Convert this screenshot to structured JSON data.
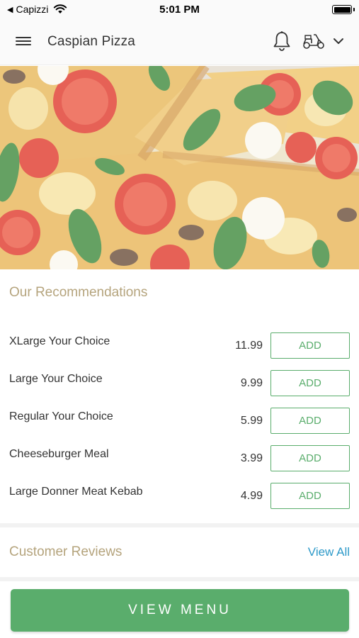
{
  "status_bar": {
    "back_label": "Capizzi",
    "time": "5:01 PM",
    "battery_percent": 100
  },
  "nav": {
    "title": "Caspian Pizza",
    "icons": [
      "menu-icon",
      "bell-icon",
      "scooter-icon",
      "chevron-down-icon"
    ]
  },
  "hero": {
    "image": "pizza-photo"
  },
  "recommendations": {
    "title": "Our Recommendations",
    "items": [
      {
        "name": "XLarge Your Choice",
        "price": "11.99",
        "button": "ADD"
      },
      {
        "name": "Large Your Choice",
        "price": "9.99",
        "button": "ADD"
      },
      {
        "name": "Regular Your Choice",
        "price": "5.99",
        "button": "ADD"
      },
      {
        "name": "Cheeseburger Meal",
        "price": "3.99",
        "button": "ADD"
      },
      {
        "name": "Large Donner Meat Kebab",
        "price": "4.99",
        "button": "ADD"
      }
    ]
  },
  "reviews": {
    "title": "Customer Reviews",
    "view_all": "View All"
  },
  "bottom": {
    "view_menu_label": "VIEW MENU"
  },
  "colors": {
    "accent_green": "#5aad6c",
    "section_title": "#b5a47d",
    "link_blue": "#2e9ac9"
  }
}
